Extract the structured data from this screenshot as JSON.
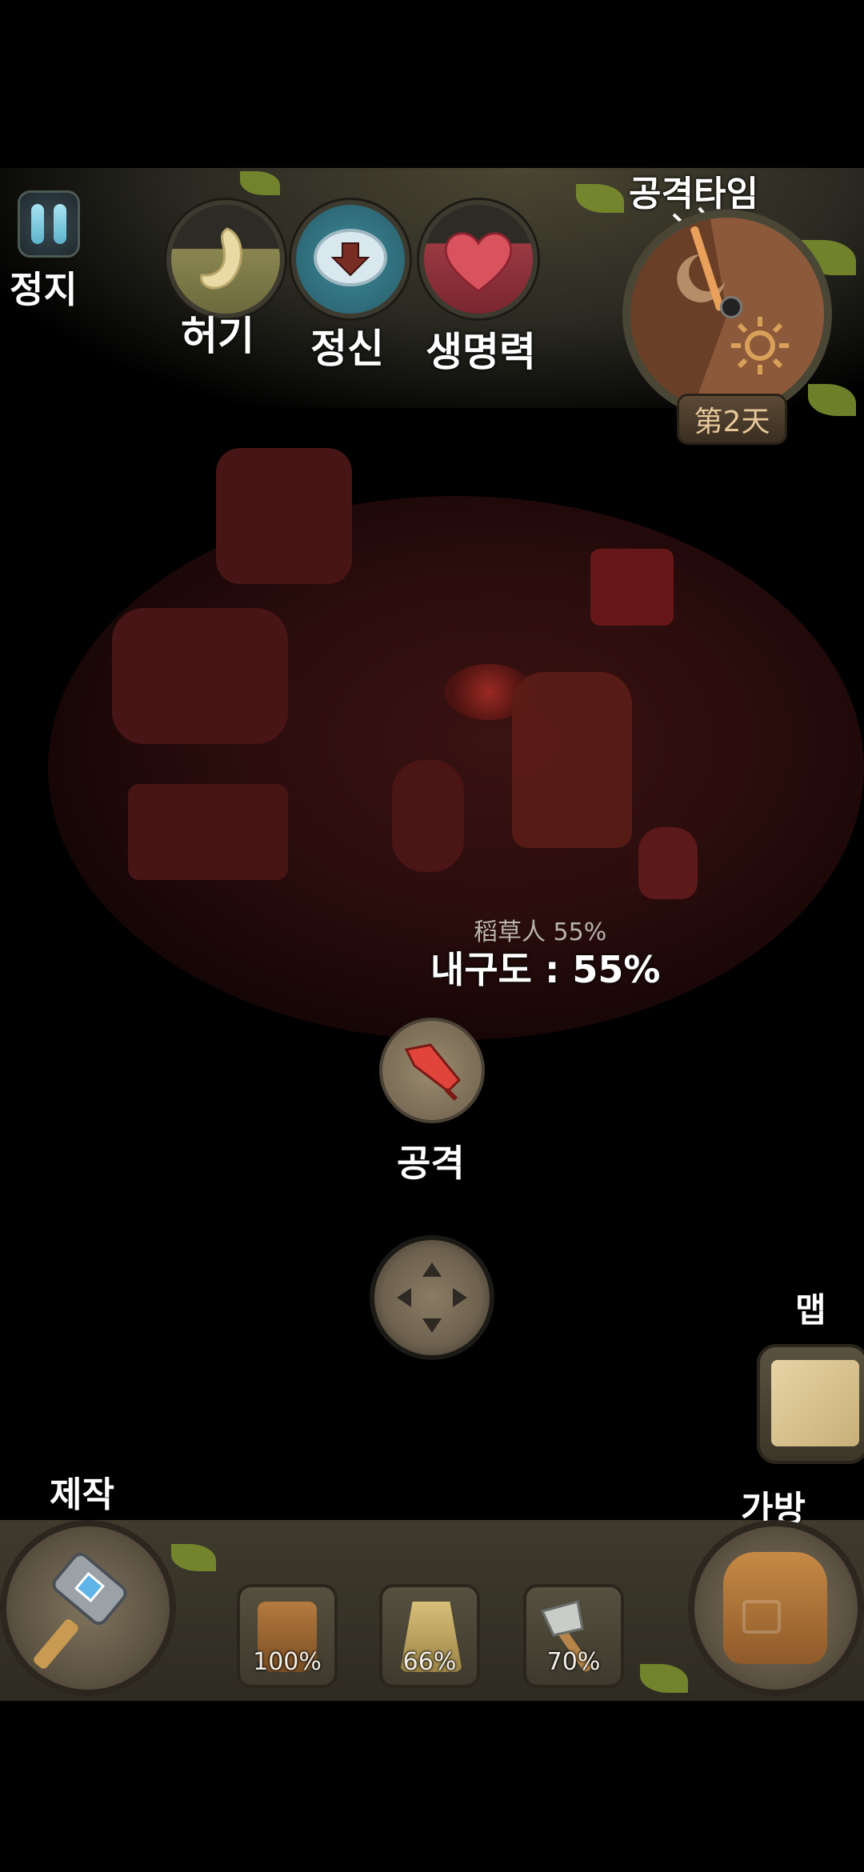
{
  "hud": {
    "pause_label": "정지",
    "hunger_label": "허기",
    "sanity_label": "정신",
    "health_label": "생명력",
    "attack_time_label": "공격타임",
    "day_badge": "第2天"
  },
  "scene": {
    "target_status": "稻草人 55%",
    "durability_label": "내구도 : 55%",
    "attack_label": "공격",
    "map_label": "맵"
  },
  "toolbar": {
    "craft_label": "제작",
    "bag_label": "가방",
    "slots": [
      {
        "item": "wooden-bucket",
        "percent": "100%"
      },
      {
        "item": "grass-skirt",
        "percent": "66%"
      },
      {
        "item": "stone-axe",
        "percent": "70%"
      }
    ]
  },
  "colors": {
    "background": "#000000",
    "label_text": "#ffffff",
    "scene_tint": "#3a1212",
    "day_badge_text": "#e7c89a"
  }
}
